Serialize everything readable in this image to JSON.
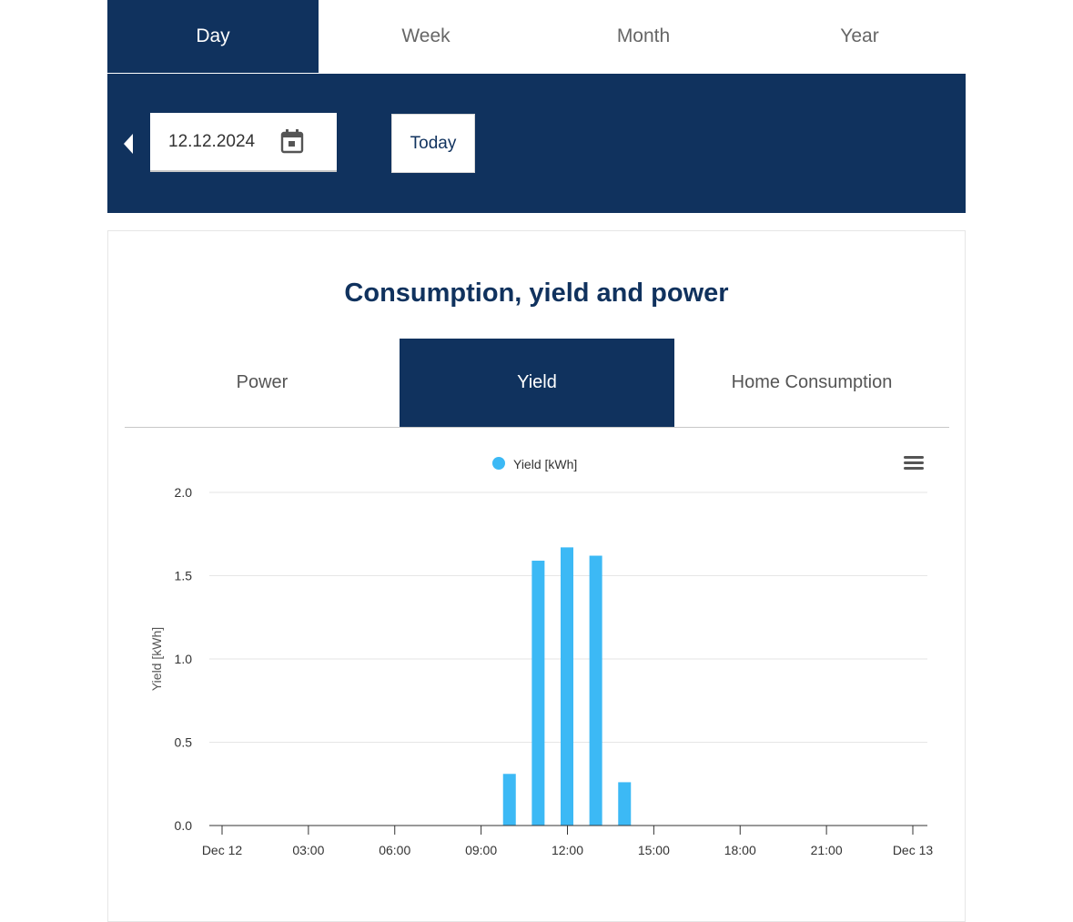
{
  "period_tabs": [
    {
      "label": "Day",
      "active": true
    },
    {
      "label": "Week",
      "active": false
    },
    {
      "label": "Month",
      "active": false
    },
    {
      "label": "Year",
      "active": false
    }
  ],
  "date_bar": {
    "date_value": "12.12.2024",
    "today_label": "Today",
    "prev_icon": "triangle-left-icon",
    "calendar_icon": "calendar-icon"
  },
  "card": {
    "title": "Consumption, yield and power",
    "tabs": [
      {
        "label": "Power",
        "active": false
      },
      {
        "label": "Yield",
        "active": true
      },
      {
        "label": "Home Consumption",
        "active": false
      }
    ],
    "menu_icon": "hamburger-menu-icon"
  },
  "colors": {
    "navy": "#10325e",
    "bar": "#3cb9f5",
    "grid": "#e6e6e6"
  },
  "chart_data": {
    "type": "bar",
    "legend": "Yield [kWh]",
    "legend_position": "top-center",
    "ylabel": "Yield [kWh]",
    "ylim": [
      0,
      2.0
    ],
    "y_ticks": [
      "0.0",
      "0.5",
      "1.0",
      "1.5",
      "2.0"
    ],
    "x_range_hours": [
      0,
      24
    ],
    "x_ticks": [
      {
        "hour": 0,
        "label": "Dec 12"
      },
      {
        "hour": 3,
        "label": "03:00"
      },
      {
        "hour": 6,
        "label": "06:00"
      },
      {
        "hour": 9,
        "label": "09:00"
      },
      {
        "hour": 12,
        "label": "12:00"
      },
      {
        "hour": 15,
        "label": "15:00"
      },
      {
        "hour": 18,
        "label": "18:00"
      },
      {
        "hour": 21,
        "label": "21:00"
      },
      {
        "hour": 24,
        "label": "Dec 13"
      }
    ],
    "series": [
      {
        "name": "Yield [kWh]",
        "points": [
          {
            "hour": 10,
            "value": 0.31
          },
          {
            "hour": 11,
            "value": 1.59
          },
          {
            "hour": 12,
            "value": 1.67
          },
          {
            "hour": 13,
            "value": 1.62
          },
          {
            "hour": 14,
            "value": 0.26
          }
        ]
      }
    ],
    "grid": true
  }
}
